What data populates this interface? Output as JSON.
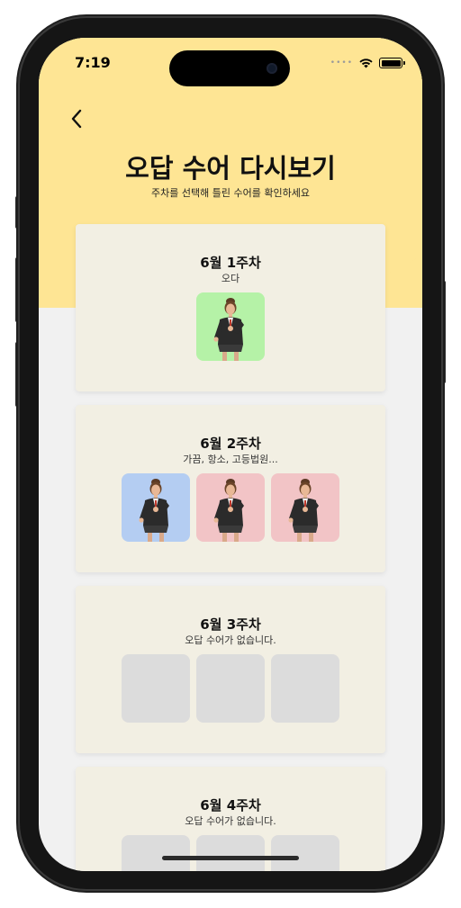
{
  "status_bar": {
    "time": "7:19"
  },
  "header": {
    "title": "오답 수어 다시보기",
    "subtitle": "주차를 선택해 틀린 수어를 확인하세요"
  },
  "colors": {
    "header_bg": "#fee594",
    "card_bg": "#f2efe3",
    "thumb_green": "#b5f2a7",
    "thumb_blue": "#b4cdf2",
    "thumb_pink": "#f2c4c6",
    "thumb_empty": "#dcdcdc"
  },
  "weeks": [
    {
      "title": "6월 1주차",
      "words": "오다",
      "thumbs": [
        {
          "color": "#b5f2a7",
          "icon": "avatar-sign-pose-icon"
        }
      ]
    },
    {
      "title": "6월 2주차",
      "words": "가끔, 항소, 고등법원...",
      "thumbs": [
        {
          "color": "#b4cdf2",
          "icon": "avatar-sign-pose-icon"
        },
        {
          "color": "#f2c4c6",
          "icon": "avatar-sign-pose-icon"
        },
        {
          "color": "#f2c4c6",
          "icon": "avatar-sign-pose-icon"
        }
      ]
    },
    {
      "title": "6월 3주차",
      "words": "오답 수어가 없습니다.",
      "thumbs": [
        {
          "empty": true
        },
        {
          "empty": true
        },
        {
          "empty": true
        }
      ]
    },
    {
      "title": "6월 4주차",
      "words": "오답 수어가 없습니다.",
      "thumbs": [
        {
          "empty": true
        },
        {
          "empty": true
        },
        {
          "empty": true
        }
      ]
    }
  ]
}
